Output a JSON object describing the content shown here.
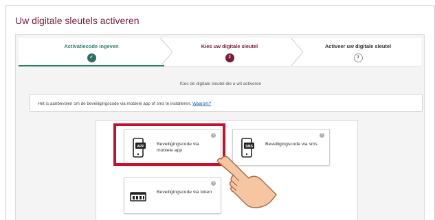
{
  "page": {
    "title": "Uw digitale sleutels activeren"
  },
  "stepper": {
    "steps": [
      {
        "label": "Activatiecode ingeven",
        "state": "done",
        "marker": "✔"
      },
      {
        "label": "Kies uw digitale sleutel",
        "state": "active",
        "marker": "2"
      },
      {
        "label": "Activeer uw digitale sleutel",
        "state": "todo",
        "marker": "3"
      }
    ]
  },
  "instruction": "Kies de digitale sleutel die u wil activeren",
  "notice": {
    "text": "Het is aanbevolen om de beveiligingscode via mobiele app of sms te installeren.",
    "link": "Waarom?"
  },
  "options": [
    {
      "label": "Beveiligingscode via mobiele app",
      "icon": "phone-app-icon",
      "badge": "APP",
      "highlighted": true
    },
    {
      "label": "Beveiligingscode via sms",
      "icon": "phone-sms-icon",
      "badge": "SMS",
      "highlighted": false
    },
    {
      "label": "Beveiligingscode via token",
      "icon": "token-icon",
      "highlighted": false
    }
  ],
  "info_marker": "?",
  "colors": {
    "brand": "#7a1a3a",
    "done": "#2f6e62",
    "highlight": "#c8102e",
    "link": "#1a5aa8"
  }
}
